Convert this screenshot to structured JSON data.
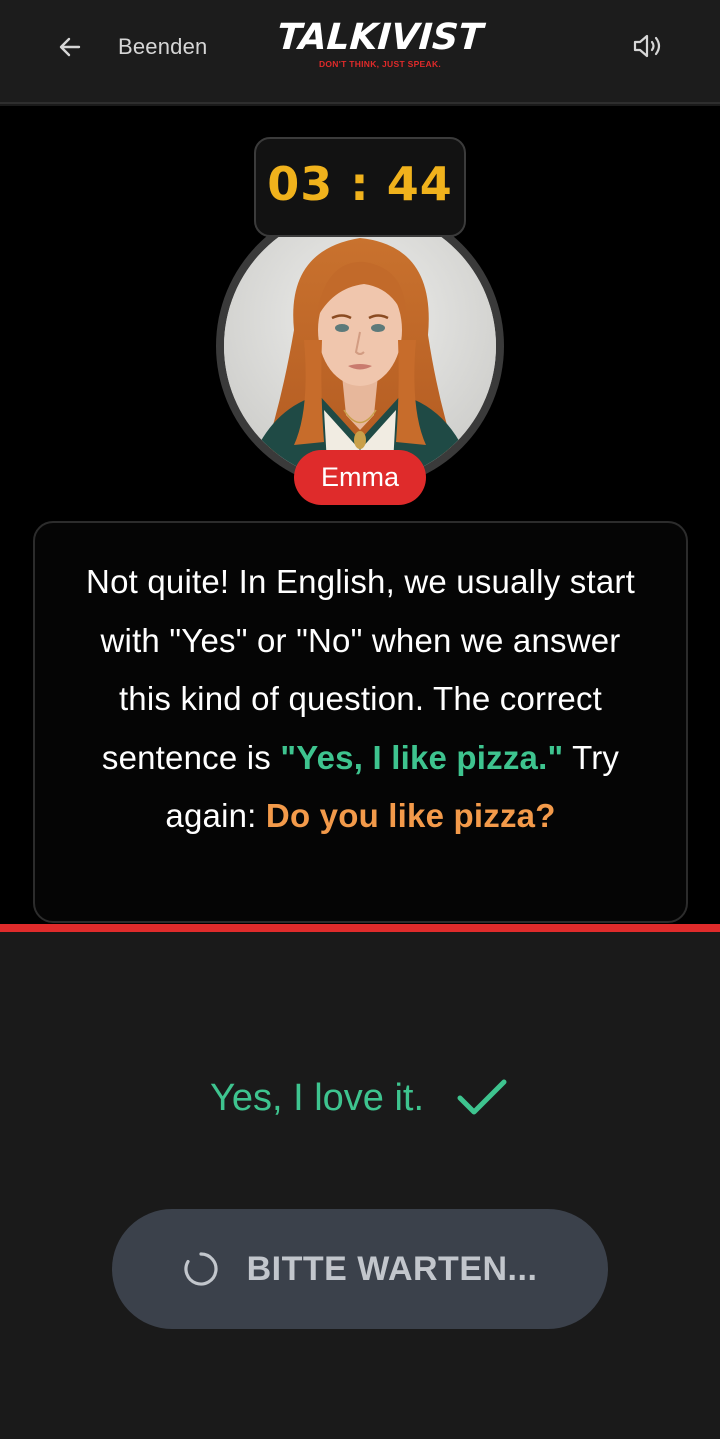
{
  "header": {
    "back_label": "Beenden",
    "back_icon": "arrow-left-icon",
    "logo_text": "TALKIVIST",
    "logo_tagline": "DON'T THINK, JUST SPEAK.",
    "sound_icon": "speaker-icon"
  },
  "session": {
    "timer": "03 : 44",
    "tutor_name": "Emma"
  },
  "message": {
    "part1": "Not quite! In English, we usually start with \"Yes\" or \"No\" when we answer this kind of question. The correct sentence is ",
    "correct_sentence": "\"Yes, I like pizza.\"",
    "part2": " Try again: ",
    "question": "Do you like pizza?"
  },
  "answer": {
    "text": "Yes, I love it.",
    "status_icon": "checkmark-icon"
  },
  "action": {
    "label": "BITTE WARTEN...",
    "icon": "spinner-icon"
  },
  "colors": {
    "accent_red": "#df2b2b",
    "timer_yellow": "#f0b21c",
    "correct_green": "#3ec48f",
    "question_orange": "#f39a4a",
    "button_bg": "#3b414b"
  }
}
